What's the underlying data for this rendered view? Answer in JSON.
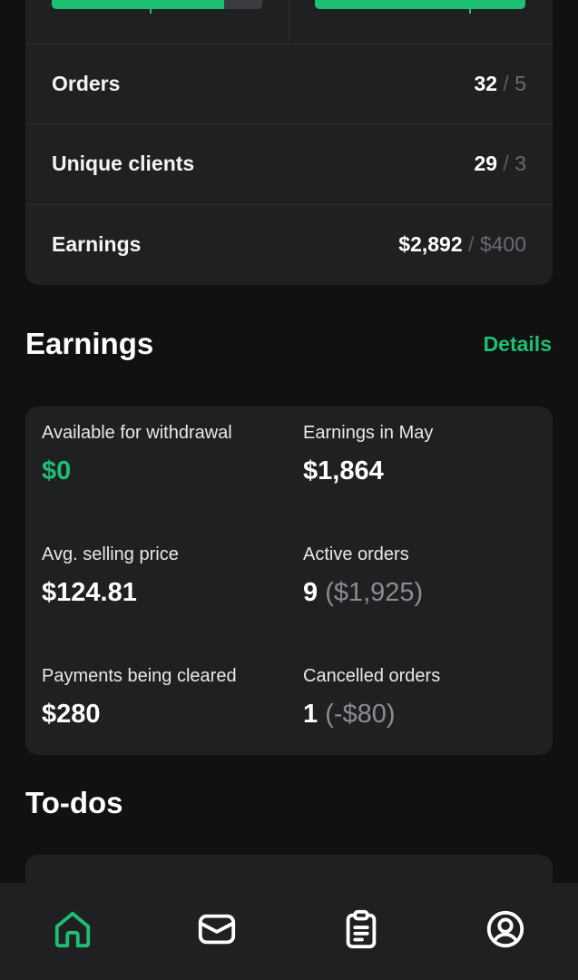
{
  "stats": {
    "rows": [
      {
        "label": "Orders",
        "current": "32",
        "target": "5"
      },
      {
        "label": "Unique clients",
        "current": "29",
        "target": "3"
      },
      {
        "label": "Earnings",
        "current": "$2,892",
        "target": "$400"
      }
    ],
    "separator": "/"
  },
  "earnings": {
    "title": "Earnings",
    "details_link": "Details",
    "metrics": [
      {
        "label": "Available for withdrawal",
        "value": "$0"
      },
      {
        "label": "Earnings in May",
        "value": "$1,864"
      },
      {
        "label": "Avg. selling price",
        "value": "$124.81"
      },
      {
        "label": "Active orders",
        "value": "9",
        "extra": "($1,925)"
      },
      {
        "label": "Payments being cleared",
        "value": "$280"
      },
      {
        "label": "Cancelled orders",
        "value": "1",
        "extra": "(-$80)"
      }
    ]
  },
  "todos": {
    "title": "To-dos"
  },
  "nav": {
    "items": [
      {
        "icon": "home-icon",
        "active": true
      },
      {
        "icon": "mail-icon",
        "active": false
      },
      {
        "icon": "orders-clipboard-icon",
        "active": false
      },
      {
        "icon": "profile-icon",
        "active": false
      }
    ]
  },
  "colors": {
    "accent": "#1dbf73",
    "card": "#1f2022",
    "background": "#111112"
  }
}
